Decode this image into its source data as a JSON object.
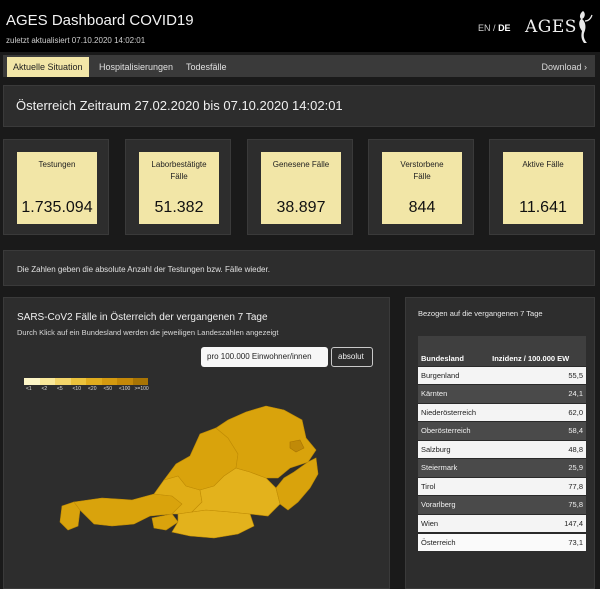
{
  "header": {
    "title": "AGES Dashboard COVID19",
    "updated": "zuletzt aktualisiert 07.10.2020 14:02:01",
    "lang_en": "EN",
    "lang_sep": "/",
    "lang_de": "DE",
    "logo_text": "AGES",
    "logo_icon": "ages-figure-logo"
  },
  "nav": {
    "tabs": [
      {
        "label": "Aktuelle Situation",
        "active": true
      },
      {
        "label": "Hospitalisierungen",
        "active": false
      },
      {
        "label": "Todesfälle",
        "active": false
      }
    ],
    "download": "Download ›"
  },
  "period": "Österreich Zeitraum 27.02.2020 bis 07.10.2020 14:02:01",
  "stats": [
    {
      "label": "Testungen",
      "value": "1.735.094"
    },
    {
      "label": "Laborbestätigte Fälle",
      "value": "51.382"
    },
    {
      "label": "Genesene Fälle",
      "value": "38.897"
    },
    {
      "label": "Verstorbene Fälle",
      "value": "844"
    },
    {
      "label": "Aktive Fälle",
      "value": "11.641"
    }
  ],
  "note": "Die Zahlen geben die absolute Anzahl der Testungen bzw. Fälle wieder.",
  "map": {
    "title": "SARS-CoV2 Fälle in Österreich der vergangenen 7 Tage",
    "subtitle": "Durch Klick auf ein Bundesland werden die jeweiligen Landeszahlen angezeigt",
    "btn_per100k": "pro 100.000 Einwohner/innen",
    "btn_absolute": "absolut",
    "legend": [
      "<1",
      "<2",
      "<5",
      "<10",
      "<20",
      "<50",
      "<100",
      ">=100"
    ],
    "legend_colors": [
      "#fdf6c8",
      "#f9e89a",
      "#f3d56a",
      "#ebc23c",
      "#e0ac1e",
      "#d49a10",
      "#c48808",
      "#a87404"
    ]
  },
  "table": {
    "heading": "Bezogen auf die vergangenen 7 Tage",
    "col_region": "Bundesland",
    "col_incidence": "Inzidenz / 100.000 EW",
    "rows": [
      {
        "name": "Burgenland",
        "value": "55,5"
      },
      {
        "name": "Kärnten",
        "value": "24,1"
      },
      {
        "name": "Niederösterreich",
        "value": "62,0"
      },
      {
        "name": "Oberösterreich",
        "value": "58,4"
      },
      {
        "name": "Salzburg",
        "value": "48,8"
      },
      {
        "name": "Steiermark",
        "value": "25,9"
      },
      {
        "name": "Tirol",
        "value": "77,8"
      },
      {
        "name": "Vorarlberg",
        "value": "75,8"
      },
      {
        "name": "Wien",
        "value": "147,4"
      }
    ],
    "total": {
      "name": "Österreich",
      "value": "73,1"
    }
  }
}
